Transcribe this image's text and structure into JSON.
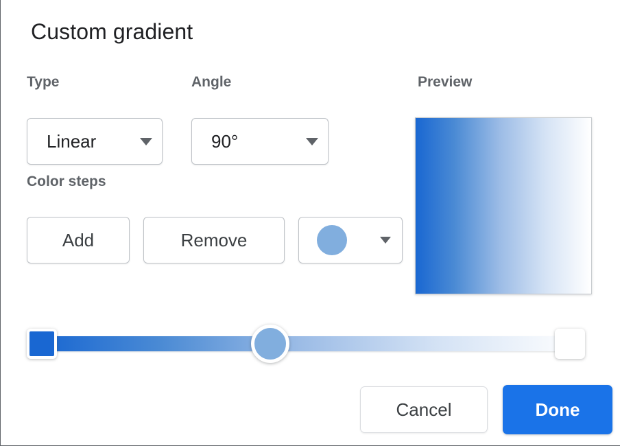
{
  "dialog": {
    "title": "Custom gradient"
  },
  "type_field": {
    "label": "Type",
    "value": "Linear",
    "caret_icon": "chevron-down-icon"
  },
  "angle_field": {
    "label": "Angle",
    "value": "90°",
    "caret_icon": "chevron-down-icon"
  },
  "preview": {
    "label": "Preview",
    "gradient_css": "linear-gradient(90deg, #1967d2 0%, #4a8ad4 22%, #9cbce6 48%, #d5e3f5 74%, #ffffff 100%)"
  },
  "color_steps": {
    "label": "Color steps",
    "add_label": "Add",
    "remove_label": "Remove",
    "swatch_icon": "color-swatch-circle-icon",
    "swatch_color": "#81aede",
    "caret_icon": "chevron-down-icon"
  },
  "slider": {
    "track_gradient_css": "linear-gradient(90deg, #1967d2 0%, #4a8ad4 22%, #9cbce6 48%, #d5e3f5 74%, #ffffff 100%)",
    "stops": [
      {
        "name": "stop-start",
        "color": "#1967d2",
        "position_percent": 0,
        "shape": "square",
        "selected": false
      },
      {
        "name": "stop-handle",
        "color": "#81aede",
        "position_percent": 45,
        "shape": "circle",
        "selected": true
      },
      {
        "name": "stop-end",
        "color": "#ffffff",
        "position_percent": 100,
        "shape": "square",
        "selected": false
      }
    ]
  },
  "actions": {
    "cancel_label": "Cancel",
    "done_label": "Done",
    "done_color": "#1a73e8"
  }
}
